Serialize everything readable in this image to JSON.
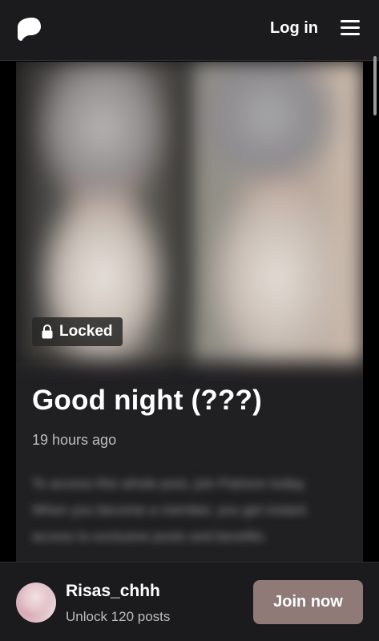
{
  "header": {
    "logo_icon": "patreon-logo-icon",
    "login_label": "Log in",
    "menu_icon": "hamburger-menu-icon"
  },
  "post": {
    "locked_label": "Locked",
    "lock_icon": "lock-icon",
    "title": "Good night (???)",
    "time": "19 hours ago",
    "teaser": "To access this whole post, join Patreon today. When you become a member, you get instant access to exclusive posts and benefits."
  },
  "footer": {
    "creator_name": "Risas_chhh",
    "unlock_text": "Unlock 120 posts",
    "join_label": "Join now"
  },
  "colors": {
    "background": "#000000",
    "header": "#1b1a1c",
    "card": "#201f21",
    "join_button": "#8f7a78"
  }
}
